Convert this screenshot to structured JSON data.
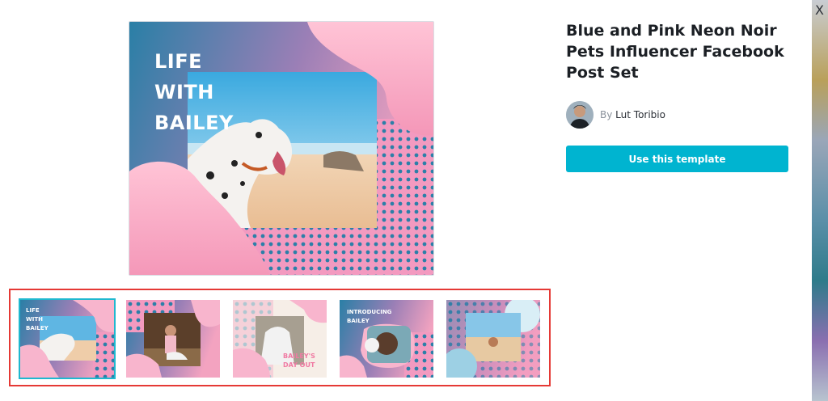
{
  "window": {
    "close_icon": "close-icon",
    "close_glyph": "X"
  },
  "preview": {
    "title_lines": [
      "LIFE",
      "WITH",
      "BAILEY"
    ]
  },
  "template": {
    "title": "Blue and Pink Neon Noir Pets Influencer Facebook Post Set",
    "author_prefix": "By",
    "author_name": "Lut Toribio",
    "use_button_label": "Use this template"
  },
  "thumbnails": [
    {
      "label": "LIFE WITH BAILEY",
      "selected": true
    },
    {
      "label": "",
      "selected": false
    },
    {
      "label": "BAILEY'S DAY OUT",
      "selected": false
    },
    {
      "label": "INTRODUCING BAILEY",
      "selected": false
    },
    {
      "label": "",
      "selected": false
    }
  ],
  "colors": {
    "accent": "#00b4d0",
    "selected_outline": "#1fb8cf",
    "highlight_box": "#e53935",
    "brand_blue": "#2f7fa8",
    "brand_pink": "#f8a9c3"
  }
}
